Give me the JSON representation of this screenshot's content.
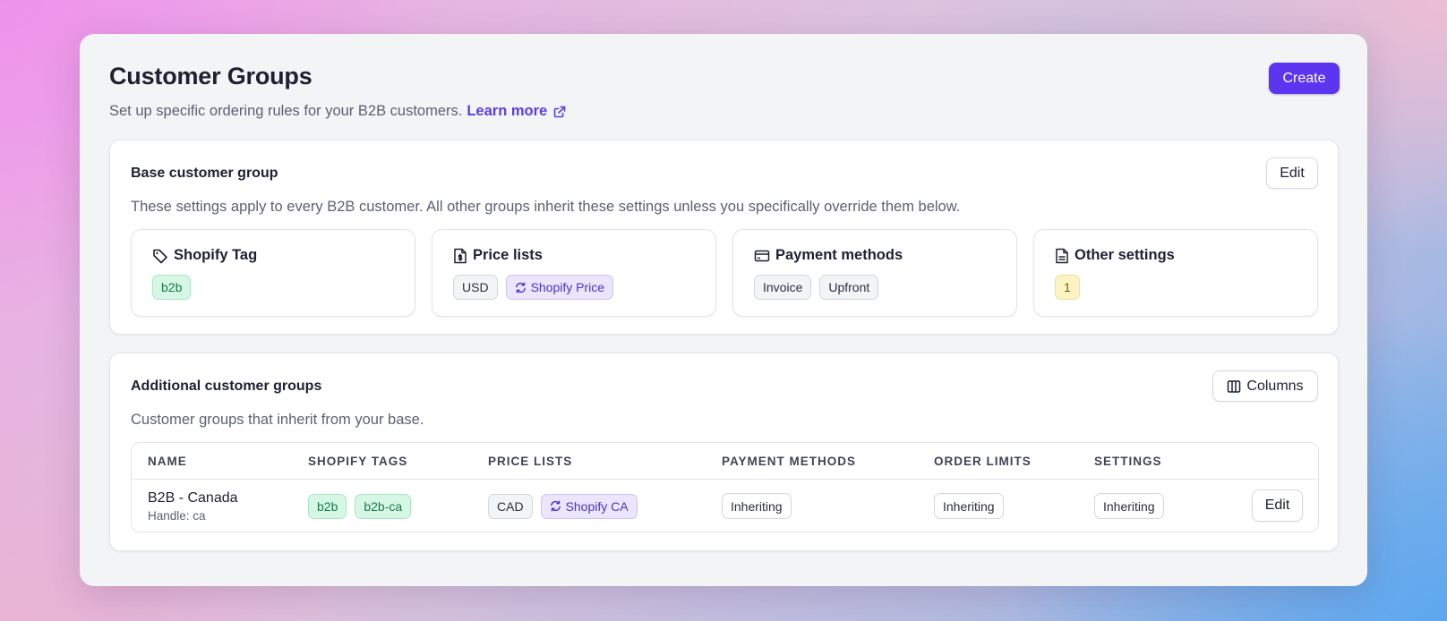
{
  "header": {
    "title": "Customer Groups",
    "subtitle": "Set up specific ordering rules for your B2B customers.",
    "learn_more": "Learn more",
    "create_label": "Create"
  },
  "base_group": {
    "title": "Base customer group",
    "edit_label": "Edit",
    "description": "These settings apply to every B2B customer. All other groups inherit these settings unless you specifically override them below.",
    "tiles": {
      "shopify_tag": {
        "title": "Shopify Tag",
        "icon": "tag-icon",
        "badges": [
          "b2b"
        ]
      },
      "price_lists": {
        "title": "Price lists",
        "icon": "file-dollar-icon",
        "badges": [
          "USD",
          "Shopify Price"
        ]
      },
      "payment_methods": {
        "title": "Payment methods",
        "icon": "credit-card-icon",
        "badges": [
          "Invoice",
          "Upfront"
        ]
      },
      "other_settings": {
        "title": "Other settings",
        "icon": "document-icon",
        "badges": [
          "1"
        ]
      }
    }
  },
  "additional_groups": {
    "title": "Additional customer groups",
    "columns_label": "Columns",
    "description": "Customer groups that inherit from your base.",
    "table": {
      "headers": [
        "NAME",
        "SHOPIFY TAGS",
        "PRICE LISTS",
        "PAYMENT METHODS",
        "ORDER LIMITS",
        "SETTINGS"
      ],
      "rows": [
        {
          "name": "B2B - Canada",
          "handle": "Handle: ca",
          "tags": [
            "b2b",
            "b2b-ca"
          ],
          "price_lists": [
            "CAD",
            "Shopify CA"
          ],
          "payment_methods": "Inheriting",
          "order_limits": "Inheriting",
          "settings": "Inheriting",
          "edit_label": "Edit"
        }
      ]
    }
  },
  "colors": {
    "accent": "#5b35f0",
    "badge_green": "#d7f7e6",
    "badge_purple": "#ebe6fc",
    "badge_yellow": "#fdf4c4"
  }
}
